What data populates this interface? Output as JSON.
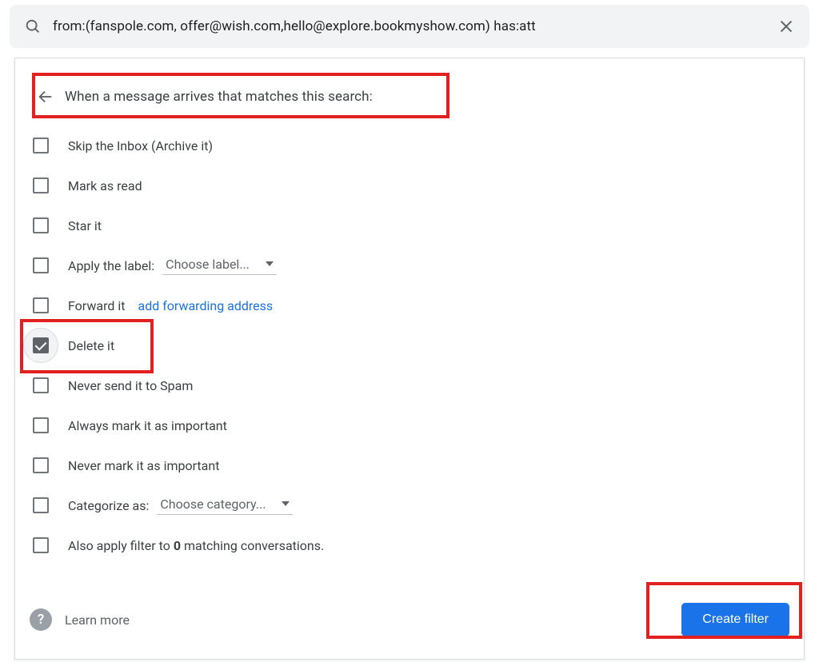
{
  "search": {
    "query": "from:(fanspole.com, offer@wish.com,hello@explore.bookmyshow.com) has:att"
  },
  "header": {
    "title": "When a message arrives that matches this search:"
  },
  "options": {
    "skip_inbox": {
      "label": "Skip the Inbox (Archive it)",
      "checked": false
    },
    "mark_read": {
      "label": "Mark as read",
      "checked": false
    },
    "star": {
      "label": "Star it",
      "checked": false
    },
    "apply_label": {
      "label": "Apply the label:",
      "checked": false,
      "select": "Choose label..."
    },
    "forward": {
      "label": "Forward it",
      "checked": false,
      "link": "add forwarding address"
    },
    "delete": {
      "label": "Delete it",
      "checked": true
    },
    "never_spam": {
      "label": "Never send it to Spam",
      "checked": false
    },
    "always_important": {
      "label": "Always mark it as important",
      "checked": false
    },
    "never_important": {
      "label": "Never mark it as important",
      "checked": false
    },
    "categorize": {
      "label": "Categorize as:",
      "checked": false,
      "select": "Choose category..."
    },
    "also_apply": {
      "prefix": "Also apply filter to ",
      "count": "0",
      "suffix": " matching conversations.",
      "checked": false
    }
  },
  "footer": {
    "learn_more": "Learn more",
    "create_button": "Create filter"
  }
}
